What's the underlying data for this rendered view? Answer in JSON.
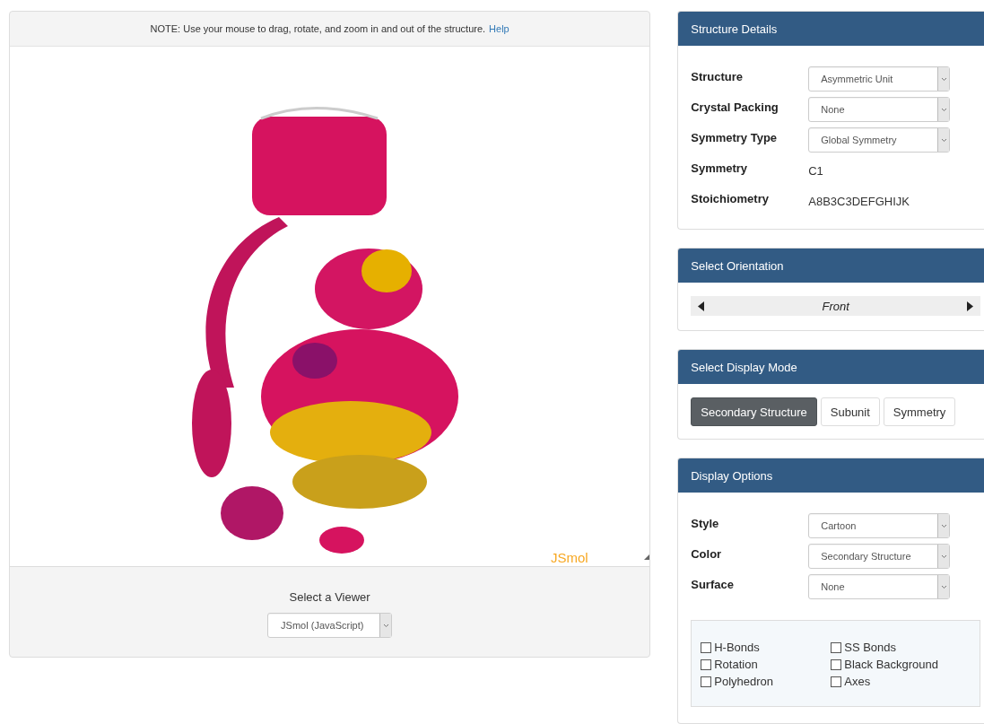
{
  "note": {
    "text": "NOTE: Use your mouse to drag, rotate, and zoom in and out of the structure.",
    "link": "Help"
  },
  "viewer": {
    "logo": "JSmol"
  },
  "viewer_select": {
    "label": "Select a Viewer",
    "value": "JSmol (JavaScript)"
  },
  "structure_details": {
    "title": "Structure Details",
    "rows": [
      {
        "label": "Structure",
        "kind": "select",
        "value": "Asymmetric Unit"
      },
      {
        "label": "Crystal Packing",
        "kind": "select",
        "value": "None"
      },
      {
        "label": "Symmetry Type",
        "kind": "select",
        "value": "Global Symmetry"
      },
      {
        "label": "Symmetry",
        "kind": "text",
        "value": "C1"
      },
      {
        "label": "Stoichiometry",
        "kind": "text",
        "value": "A8B3C3DEFGHIJK"
      }
    ]
  },
  "orientation": {
    "title": "Select Orientation",
    "value": "Front"
  },
  "display_mode": {
    "title": "Select Display Mode",
    "buttons": [
      {
        "label": "Secondary Structure",
        "selected": true
      },
      {
        "label": "Subunit",
        "selected": false
      },
      {
        "label": "Symmetry",
        "selected": false
      }
    ]
  },
  "display_options": {
    "title": "Display Options",
    "rows": [
      {
        "label": "Style",
        "kind": "select",
        "value": "Cartoon"
      },
      {
        "label": "Color",
        "kind": "select",
        "value": "Secondary Structure"
      },
      {
        "label": "Surface",
        "kind": "select",
        "value": "None"
      }
    ],
    "checkboxes": [
      {
        "label": "H-Bonds",
        "checked": false
      },
      {
        "label": "SS Bonds",
        "checked": false
      },
      {
        "label": "Rotation",
        "checked": false
      },
      {
        "label": "Black Background",
        "checked": false
      },
      {
        "label": "Polyhedron",
        "checked": false
      },
      {
        "label": "Axes",
        "checked": false
      }
    ]
  }
}
